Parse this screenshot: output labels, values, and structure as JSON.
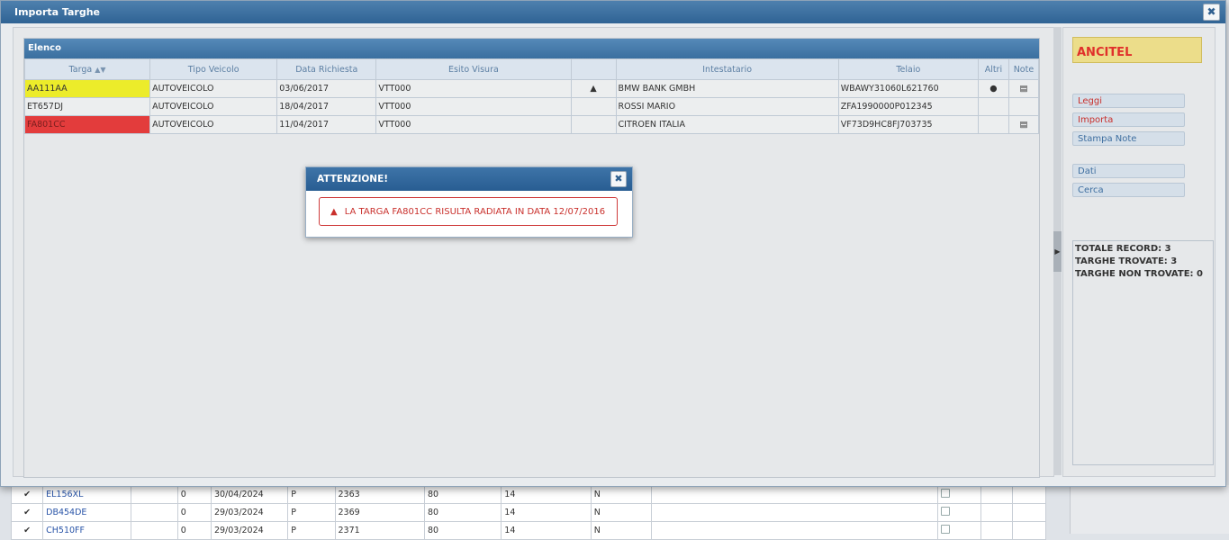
{
  "window": {
    "title": "Importa Targhe"
  },
  "grid": {
    "title": "Elenco",
    "columns": [
      "Targa",
      "Tipo Veicolo",
      "Data Richiesta",
      "Esito Visura",
      "",
      "Intestatario",
      "Telaio",
      "Altri",
      "Note"
    ],
    "rows": [
      {
        "targa": "AA111AA",
        "tipo": "AUTOVEICOLO",
        "data": "03/06/2017",
        "esito": "VTT000",
        "intestatario": "BMW BANK GMBH",
        "telaio": "WBAWY31060L621760"
      },
      {
        "targa": "ET657DJ",
        "tipo": "AUTOVEICOLO",
        "data": "18/04/2017",
        "esito": "VTT000",
        "intestatario": "ROSSI MARIO",
        "telaio": "ZFA1990000P012345"
      },
      {
        "targa": "FA801CC",
        "tipo": "AUTOVEICOLO",
        "data": "11/04/2017",
        "esito": "VTT000",
        "intestatario": "CITROEN ITALIA",
        "telaio": "VF73D9HC8FJ703735"
      }
    ]
  },
  "side": {
    "brand": "ANCITEL",
    "buttons": [
      "Leggi",
      "Importa",
      "Stampa Note",
      "Dati",
      "Cerca"
    ],
    "summary": [
      "TOTALE RECORD: 3",
      "TARGHE TROVATE: 3",
      "TARGHE NON TROVATE: 0"
    ]
  },
  "dialog": {
    "title": "ATTENZIONE!",
    "message": "LA TARGA FA801CC RISULTA RADIATA IN DATA 12/07/2016"
  },
  "background": {
    "rows": [
      {
        "plate": "EL156XL",
        "c1": "0",
        "date": "30/04/2024",
        "c3": "P",
        "c4": "2363",
        "c5": "80",
        "c6": "14",
        "c7": "N"
      },
      {
        "plate": "DB454DE",
        "c1": "0",
        "date": "29/03/2024",
        "c3": "P",
        "c4": "2369",
        "c5": "80",
        "c6": "14",
        "c7": "N"
      },
      {
        "plate": "CH510FF",
        "c1": "0",
        "date": "29/03/2024",
        "c3": "P",
        "c4": "2371",
        "c5": "80",
        "c6": "14",
        "c7": "N"
      }
    ]
  }
}
